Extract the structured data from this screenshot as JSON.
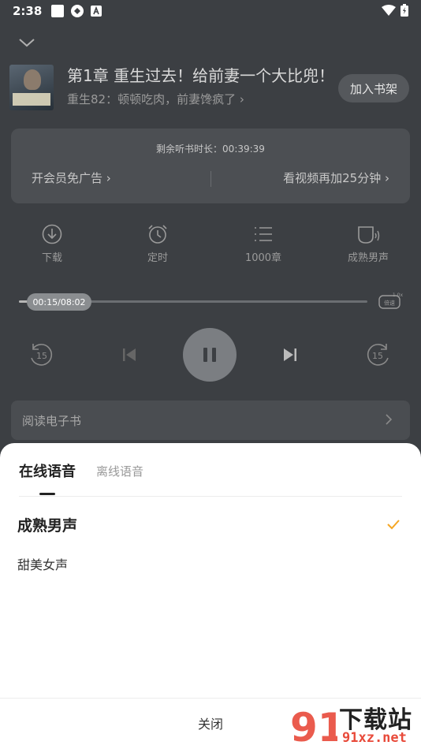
{
  "status_bar": {
    "time": "2:38"
  },
  "book": {
    "chapter_title": "第1章  重生过去！给前妻一个大比兜！",
    "subtitle": "重生82：顿顿吃肉，前妻馋疯了",
    "add_shelf_label": "加入书架"
  },
  "listen_card": {
    "remaining_label": "剩余听书时长：00:39:39",
    "vip_label": "开会员免广告",
    "video_label": "看视频再加25分钟"
  },
  "functions": [
    {
      "label": "下载",
      "icon": "download-icon"
    },
    {
      "label": "定时",
      "icon": "alarm-icon"
    },
    {
      "label": "1000章",
      "icon": "list-icon"
    },
    {
      "label": "成熟男声",
      "icon": "voice-icon"
    }
  ],
  "player": {
    "time_display": "00:15/08:02",
    "progress": 0.031,
    "speed_label": "倍速",
    "speed_value": "1.0x",
    "rewind_label": "15",
    "forward_label": "15"
  },
  "ebook": {
    "label": "阅读电子书"
  },
  "sheet": {
    "tab_online": "在线语音",
    "tab_offline": "离线语音",
    "voices": [
      {
        "label": "成熟男声",
        "selected": true
      },
      {
        "label": "甜美女声",
        "selected": false
      }
    ],
    "close_label": "关闭"
  },
  "watermark": {
    "text_cn": "下载站",
    "text_url": "91xz.net",
    "logo_text": "91"
  },
  "colors": {
    "accent": "#f5a623",
    "overlay": "#3c3f43"
  }
}
